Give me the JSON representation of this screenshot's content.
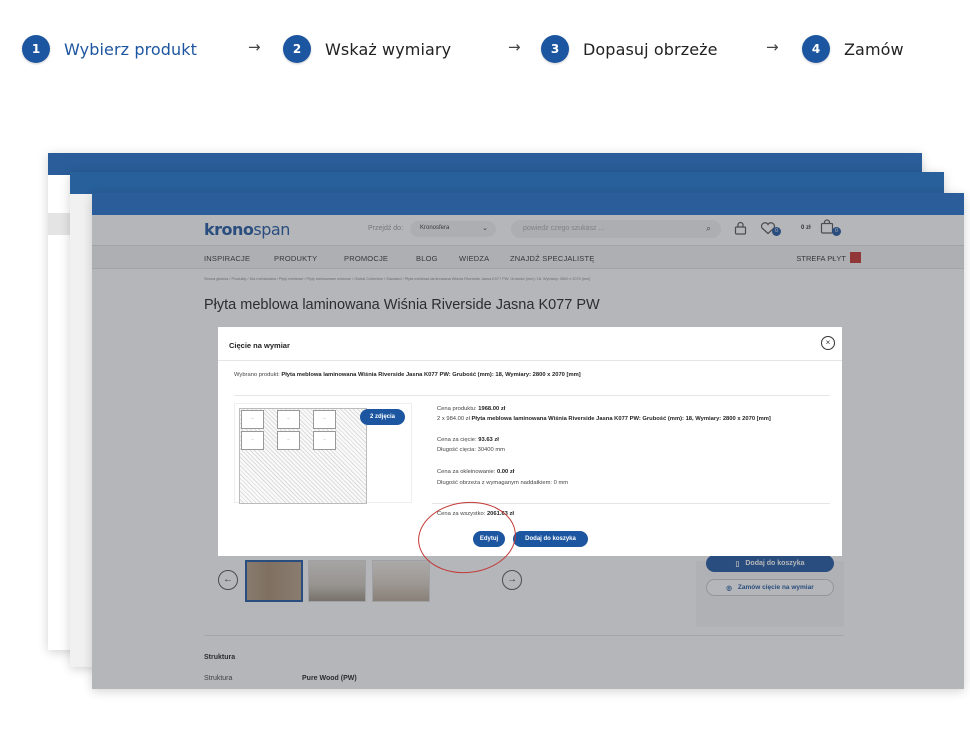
{
  "steps": [
    {
      "num": "1",
      "label": "Wybierz produkt",
      "active": true
    },
    {
      "num": "2",
      "label": "Wskaż wymiary"
    },
    {
      "num": "3",
      "label": "Dopasuj obrzeże"
    },
    {
      "num": "4",
      "label": "Zamów"
    }
  ],
  "arrow": "→",
  "site": {
    "logo_bold": "krono",
    "logo_thin": "span",
    "goto_label": "Przejdź do:",
    "goto_value": "Kronosfera",
    "search_placeholder": "powiedz czego szukasz ...",
    "cart_value": "0 zł",
    "badge_count": "0",
    "nav": [
      "INSPIRACJE",
      "PRODUKTY",
      "PROMOCJE",
      "BLOG",
      "WIEDZA",
      "ZNAJDŹ SPECJALISTĘ"
    ],
    "zone": "STREFA PŁYT",
    "breadcrumb": "Strona główna / Produkty / Dla meblarstwa / Płyty meblowe / Płyty laminowane wiórowe / Global Collection / Standard / Płyta meblowa laminowana Wiśnia Riverside Jasna K077 PW: Grubość (mm): 18, Wymiary: 2800 x 2070 [mm]",
    "product_title": "Płyta meblowa laminowana Wiśnia Riverside Jasna K077 PW",
    "add_to_cart": "Dodaj do koszyka",
    "order_cut": "Zamów cięcie na wymiar",
    "structure_heading": "Struktura",
    "structure_key": "Struktura",
    "structure_value": "Pure Wood (PW)"
  },
  "modal": {
    "title": "Cięcie na wymiar",
    "close": "×",
    "selected_label": "Wybrano produkt:",
    "selected_value": "Płyta meblowa laminowana Wiśnia Riverside Jasna K077 PW: Grubość (mm): 18, Wymiary: 2800 x 2070 [mm]",
    "photos_btn": "2 zdjęcia",
    "price_label": "Cena produktu:",
    "price_value": "1968.00 zł",
    "qty_line_prefix": "2 x 984.00 zł",
    "qty_line_product": "Płyta meblowa laminowana Wiśnia Riverside Jasna K077 PW: Grubość (mm): 18, Wymiary: 2800 x 2070 [mm]",
    "cut_price_label": "Cena za cięcie:",
    "cut_price_value": "93.63 zł",
    "cut_length": "Długość cięcia: 30400 mm",
    "edge_price_label": "Cena za okleinowanie:",
    "edge_price_value": "0.00 zł",
    "edge_length": "Długość obrzeża z wymaganym naddatkiem: 0 mm",
    "total_label": "Cena za wszystko:",
    "total_value": "2061.63 zł",
    "edit_btn": "Edytuj",
    "add_btn": "Dodaj do koszyka"
  },
  "colors": {
    "accent": "#1d56a0",
    "highlight_ring": "#c23a36"
  }
}
